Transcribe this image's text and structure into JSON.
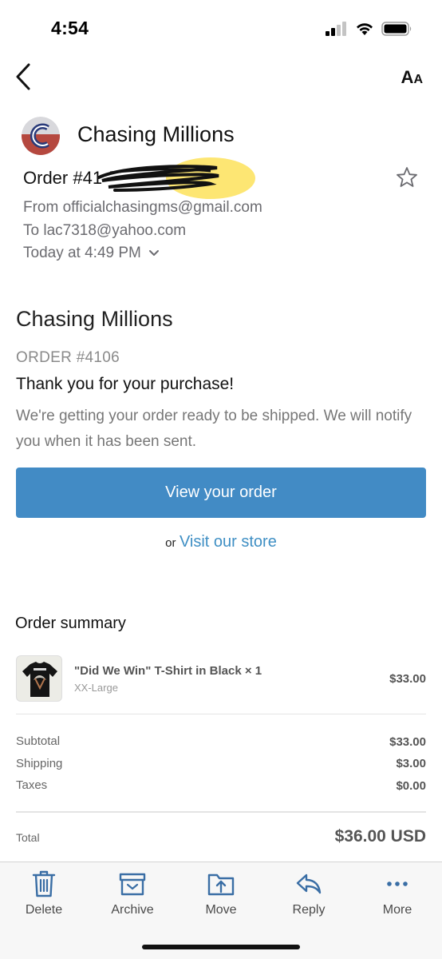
{
  "status_bar": {
    "time": "4:54"
  },
  "nav": {
    "back_icon": "chevron-left-icon",
    "font_size_label_large": "A",
    "font_size_label_small": "A"
  },
  "email_header": {
    "sender_name": "Chasing Millions",
    "subject_visible": "Order #41",
    "from": "From officialchasingms@gmail.com",
    "to": "To lac7318@yahoo.com",
    "date": "Today at 4:49 PM"
  },
  "email_body": {
    "shop_name": "Chasing Millions",
    "order_number": "ORDER #4106",
    "thanks": "Thank you for your purchase!",
    "message": "We're getting your order ready to be shipped. We will notify you when it has been sent.",
    "view_order_button": "View your order",
    "visit_or": "or",
    "visit_store_link": "Visit our store"
  },
  "order_summary": {
    "title": "Order summary",
    "items": [
      {
        "name": "\"Did We Win\" T-Shirt in Black × 1",
        "variant": "XX-Large",
        "price": "$33.00"
      }
    ],
    "subtotal_label": "Subtotal",
    "subtotal_value": "$33.00",
    "shipping_label": "Shipping",
    "shipping_value": "$3.00",
    "taxes_label": "Taxes",
    "taxes_value": "$0.00",
    "total_label": "Total",
    "total_value": "$36.00 USD"
  },
  "toolbar": {
    "delete": "Delete",
    "archive": "Archive",
    "move": "Move",
    "reply": "Reply",
    "more": "More"
  },
  "colors": {
    "button_blue": "#428bc5",
    "link_blue": "#3f8fc4",
    "redaction_highlight": "#fde25a"
  }
}
